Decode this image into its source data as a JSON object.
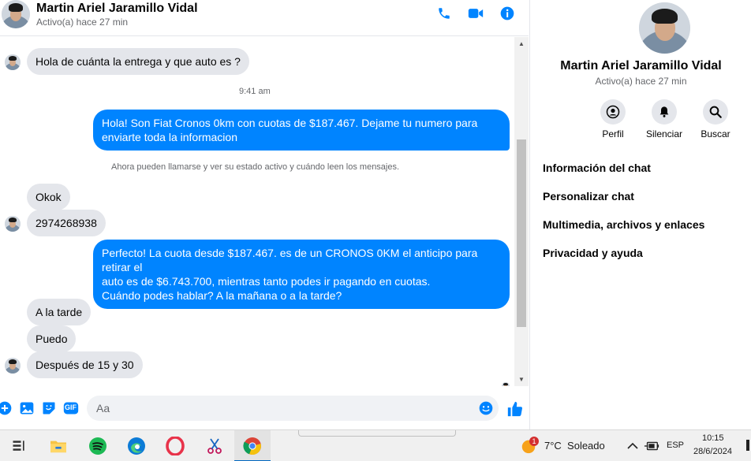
{
  "header": {
    "name": "Martin Ariel Jaramillo Vidal",
    "status": "Activo(a) hace 27 min",
    "icons": [
      "phone-icon",
      "video-icon",
      "info-icon"
    ]
  },
  "messages": {
    "m1": "Hola de cuánta la entrega y que auto es ?",
    "time": "9:41 am",
    "m2": "Hola! Son Fiat Cronos 0km con cuotas de $187.467. Dejame tu numero para enviarte toda la informacion",
    "notice": "Ahora pueden llamarse y ver su estado activo y cuándo leen los mensajes.",
    "m3": "Okok",
    "m4": "2974268938",
    "m5_line1": "Perfecto! La cuota desde $187.467. es de un CRONOS 0KM el anticipo para retirar el",
    "m5_line2": "auto es de $6.743.700, mientras tanto podes ir pagando en cuotas.",
    "m5_line3": "Cuándo podes hablar? A la mañana o a la tarde?",
    "m6": "A la tarde",
    "m7": "Puedo",
    "m8": "Después de 15 y 30"
  },
  "composer": {
    "placeholder": "Aa",
    "icons": [
      "plus-icon",
      "image-icon",
      "sticker-icon",
      "gif-icon",
      "emoji-icon",
      "like-icon"
    ],
    "gif_label": "GIF"
  },
  "panel": {
    "name": "Martin Ariel Jaramillo Vidal",
    "status": "Activo(a) hace 27 min",
    "actions": [
      {
        "label": "Perfil",
        "icon": "profile-icon"
      },
      {
        "label": "Silenciar",
        "icon": "bell-icon"
      },
      {
        "label": "Buscar",
        "icon": "search-icon"
      }
    ],
    "menu": [
      "Información del chat",
      "Personalizar chat",
      "Multimedia, archivos y enlaces",
      "Privacidad y ayuda"
    ]
  },
  "taskbar": {
    "weather": "7°C  Soleado",
    "weather_badge": "1",
    "lang": "ESP",
    "time": "10:15",
    "date": "28/6/2024",
    "apps": [
      "task-view-icon",
      "file-explorer-icon",
      "spotify-icon",
      "edge-icon",
      "opera-icon",
      "snipping-tool-icon",
      "chrome-icon"
    ]
  },
  "colors": {
    "accent": "#0084ff",
    "incoming_bubble": "#e4e6eb"
  }
}
